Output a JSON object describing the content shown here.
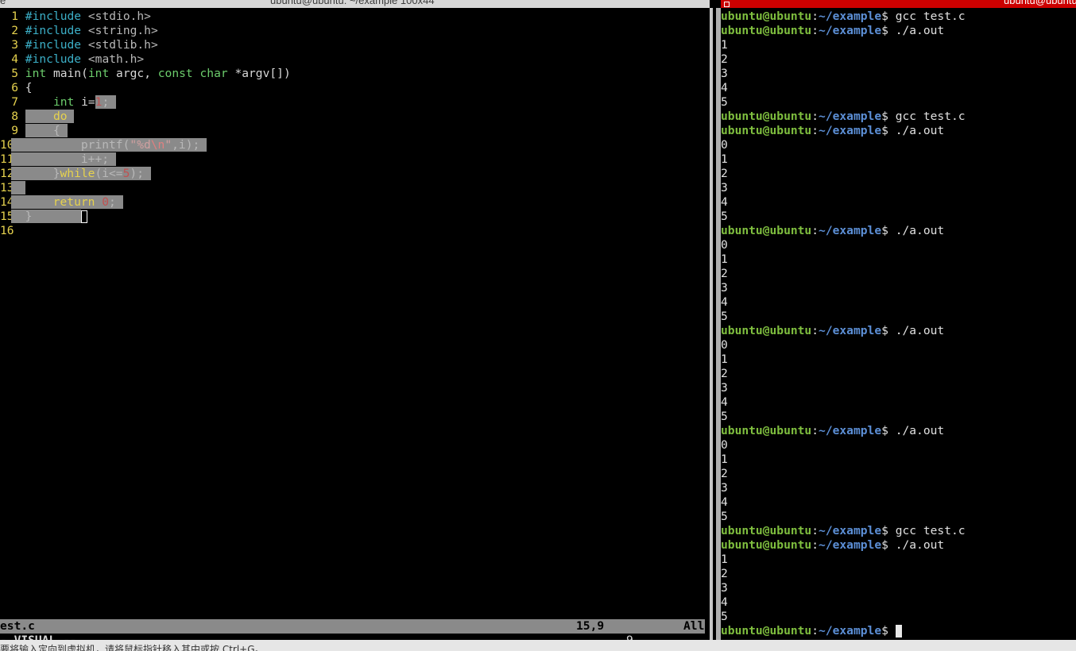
{
  "window": {
    "left_title": "ubuntu@ubuntu: ~/example 100x44",
    "right_title": "ubuntu@ubuntu",
    "left_edge_glyph": "e"
  },
  "vim": {
    "lines": [
      {
        "n": "1",
        "code": "#include <stdio.h>"
      },
      {
        "n": "2",
        "code": "#include <string.h>"
      },
      {
        "n": "3",
        "code": "#include <stdlib.h>"
      },
      {
        "n": "4",
        "code": "#include <math.h>"
      },
      {
        "n": "5",
        "code": "int main(int argc, const char *argv[])"
      },
      {
        "n": "6",
        "code": "{"
      },
      {
        "n": "7",
        "code": "    int i=1;"
      },
      {
        "n": "8",
        "code": "    do"
      },
      {
        "n": "9",
        "code": "    {"
      },
      {
        "n": "10",
        "code": "        printf(\"%d\\n\",i);"
      },
      {
        "n": "11",
        "code": "        i++;"
      },
      {
        "n": "12",
        "code": "    }while(i<=5);"
      },
      {
        "n": "13",
        "code": ""
      },
      {
        "n": "14",
        "code": "    return 0;"
      },
      {
        "n": "15",
        "code": "}"
      },
      {
        "n": "16",
        "code": ""
      }
    ],
    "parts": {
      "include": "#include",
      "stdio": "<stdio.h>",
      "string": "<string.h>",
      "stdlib": "<stdlib.h>",
      "math": "<math.h>",
      "int": "int",
      "main": "main(",
      "argc": "argc, ",
      "const": "const",
      "char": "char",
      "argv": "*argv[])",
      "open_brace": "{",
      "i_assign": "i=",
      "one": "1",
      "semi": ";",
      "do": "do",
      "printf": "printf(",
      "quote": "\"",
      "fmt": "%d",
      "esc": "\\n",
      "printf_tail": ",i);",
      "iinc": "i++;",
      "close_brace": "}",
      "while": "while",
      "cond_open": "(i<=",
      "five": "5",
      "cond_close": ");",
      "return": "return",
      "zero": "0"
    },
    "status": {
      "file": "est.c",
      "position": "15,9",
      "scroll": "All"
    },
    "cmdline": {
      "mode": "- VISUAL --",
      "count": "9"
    }
  },
  "terminal": {
    "user_host": "ubuntu@ubuntu",
    "colon": ":",
    "path": "~/example",
    "dollar": "$",
    "lines": [
      {
        "type": "prompt",
        "cmd": " gcc test.c"
      },
      {
        "type": "prompt",
        "cmd": " ./a.out"
      },
      {
        "type": "out",
        "text": "1"
      },
      {
        "type": "out",
        "text": "2"
      },
      {
        "type": "out",
        "text": "3"
      },
      {
        "type": "out",
        "text": "4"
      },
      {
        "type": "out",
        "text": "5"
      },
      {
        "type": "prompt",
        "cmd": " gcc test.c"
      },
      {
        "type": "prompt",
        "cmd": " ./a.out"
      },
      {
        "type": "out",
        "text": "0"
      },
      {
        "type": "out",
        "text": "1"
      },
      {
        "type": "out",
        "text": "2"
      },
      {
        "type": "out",
        "text": "3"
      },
      {
        "type": "out",
        "text": "4"
      },
      {
        "type": "out",
        "text": "5"
      },
      {
        "type": "prompt",
        "cmd": " ./a.out"
      },
      {
        "type": "out",
        "text": "0"
      },
      {
        "type": "out",
        "text": "1"
      },
      {
        "type": "out",
        "text": "2"
      },
      {
        "type": "out",
        "text": "3"
      },
      {
        "type": "out",
        "text": "4"
      },
      {
        "type": "out",
        "text": "5"
      },
      {
        "type": "prompt",
        "cmd": " ./a.out"
      },
      {
        "type": "out",
        "text": "0"
      },
      {
        "type": "out",
        "text": "1"
      },
      {
        "type": "out",
        "text": "2"
      },
      {
        "type": "out",
        "text": "3"
      },
      {
        "type": "out",
        "text": "4"
      },
      {
        "type": "out",
        "text": "5"
      },
      {
        "type": "prompt",
        "cmd": " ./a.out"
      },
      {
        "type": "out",
        "text": "0"
      },
      {
        "type": "out",
        "text": "1"
      },
      {
        "type": "out",
        "text": "2"
      },
      {
        "type": "out",
        "text": "3"
      },
      {
        "type": "out",
        "text": "4"
      },
      {
        "type": "out",
        "text": "5"
      },
      {
        "type": "prompt",
        "cmd": " gcc test.c"
      },
      {
        "type": "prompt",
        "cmd": " ./a.out"
      },
      {
        "type": "out",
        "text": "1"
      },
      {
        "type": "out",
        "text": "2"
      },
      {
        "type": "out",
        "text": "3"
      },
      {
        "type": "out",
        "text": "4"
      },
      {
        "type": "out",
        "text": "5"
      },
      {
        "type": "prompt",
        "cmd": " ",
        "cursor": true
      }
    ]
  },
  "bottom_bar": {
    "text": "要将输入定向到虚拟机，请将鼠标指针移入其中或按 Ctrl+G。"
  },
  "colors": {
    "line_number": "#e6d24e",
    "preproc": "#3cb0c8",
    "type": "#6ccd6c",
    "keyword": "#e6d24e",
    "visual_highlight": "#8a8a8a",
    "prompt_user": "#7fbf3f",
    "prompt_path": "#5c8fd6",
    "right_titlebar": "#cc0000"
  }
}
